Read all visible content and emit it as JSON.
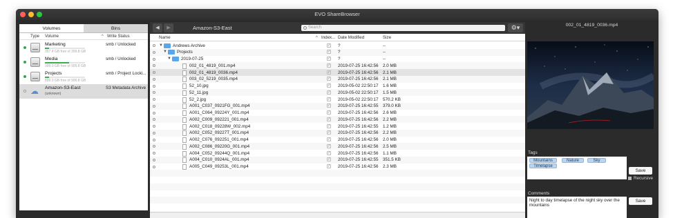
{
  "window": {
    "title": "EVO ShareBrowser"
  },
  "left": {
    "tabs": [
      "Volumes",
      "Bins"
    ],
    "columns": [
      "Type",
      "Volume",
      "Write Status"
    ],
    "volumes": [
      {
        "name": "Marketing",
        "sub": "357.4 GB free of 399.8 GB",
        "status": "smb / Unlocked",
        "online": true,
        "fill": 0.11
      },
      {
        "name": "Media",
        "sub": "399.0 GB free of 999.8 GB",
        "status": "smb / Unlocked",
        "online": true,
        "fill": 0.6
      },
      {
        "name": "Projects",
        "sub": "899.0 GB free of 999.8 GB",
        "status": "smb / Project Locki...",
        "online": true,
        "fill": 0.1
      },
      {
        "name": "Amazon-S3-East",
        "sub": "(unknown)",
        "status": "S3 Metadata Archive",
        "online": false
      }
    ]
  },
  "middle": {
    "back_icon": "◀",
    "forward_icon": "▶",
    "volume_title": "Amazon-S3-East",
    "search_placeholder": "Search",
    "gear_icon": "⚙▾",
    "columns": {
      "name": "Name",
      "index": "Index...",
      "date": "Date Modified",
      "size": "Size"
    },
    "rows": [
      {
        "level": 0,
        "kind": "folder",
        "open": true,
        "name": "Andrews Archive",
        "date": "?",
        "size": "--"
      },
      {
        "level": 1,
        "kind": "folder",
        "open": true,
        "name": "Projects",
        "date": "?",
        "size": "--"
      },
      {
        "level": 2,
        "kind": "folder",
        "open": true,
        "name": "2019-07-25",
        "date": "?",
        "size": "--"
      },
      {
        "level": 3,
        "kind": "file",
        "name": "002_01_4819_001.mp4",
        "date": "2019-07-25 16:42:56",
        "size": "2.0 MB"
      },
      {
        "level": 3,
        "kind": "file",
        "name": "002_01_4819_0036.mp4",
        "date": "2019-07-25 16:42:56",
        "size": "2.1 MB",
        "selected": true
      },
      {
        "level": 3,
        "kind": "file",
        "name": "003_02_5219_0035.mp4",
        "date": "2019-07-25 16:42:56",
        "size": "2.1 MB"
      },
      {
        "level": 3,
        "kind": "file",
        "name": "52_10.jpg",
        "date": "2019-05-02 22:50:17",
        "size": "1.6 MB"
      },
      {
        "level": 3,
        "kind": "file",
        "name": "52_11.jpg",
        "date": "2019-05-02 22:50:17",
        "size": "1.5 MB"
      },
      {
        "level": 3,
        "kind": "file",
        "name": "52_2.jpg",
        "date": "2019-05-02 22:50:17",
        "size": "570.2 KB"
      },
      {
        "level": 3,
        "kind": "file",
        "name": "A001_C037_0921FG_001.mp4",
        "date": "2019-07-25 16:42:55",
        "size": "379.0 KB"
      },
      {
        "level": 3,
        "kind": "file",
        "name": "A001_C064_09224Y_001.mp4",
        "date": "2019-07-25 16:42:56",
        "size": "2.6 MB"
      },
      {
        "level": 3,
        "kind": "file",
        "name": "A002_C009_092221_001.mp4",
        "date": "2019-07-25 16:42:56",
        "size": "2.2 MB"
      },
      {
        "level": 3,
        "kind": "file",
        "name": "A002_C018_09228W_002.mp4",
        "date": "2019-07-25 16:42:55",
        "size": "1.2 MB"
      },
      {
        "level": 3,
        "kind": "file",
        "name": "A002_C052_09227T_001.mp4",
        "date": "2019-07-25 16:42:56",
        "size": "2.2 MB"
      },
      {
        "level": 3,
        "kind": "file",
        "name": "A002_C076_092251_001.mp4",
        "date": "2019-07-25 16:42:56",
        "size": "2.0 MB"
      },
      {
        "level": 3,
        "kind": "file",
        "name": "A002_C086_09220G_001.mp4",
        "date": "2019-07-25 16:42:56",
        "size": "2.5 MB"
      },
      {
        "level": 3,
        "kind": "file",
        "name": "A004_C052_09244Q_001.mp4",
        "date": "2019-07-25 16:42:56",
        "size": "1.1 MB"
      },
      {
        "level": 3,
        "kind": "file",
        "name": "A004_C010_0924AL_001.mp4",
        "date": "2019-07-25 16:42:55",
        "size": "351.5 KB"
      },
      {
        "level": 3,
        "kind": "file",
        "name": "A005_C049_09253L_001.mp4",
        "date": "2019-07-25 16:42:56",
        "size": "2.3 MB"
      }
    ]
  },
  "right": {
    "preview_title": "002_01_4819_0036.mp4",
    "tags_label": "Tags",
    "tags": [
      "Mountains",
      "Nature",
      "Sky",
      "Timelapse"
    ],
    "save_label": "Save",
    "recursive_label": "Recursive",
    "comments_label": "Comments",
    "comment_text": "Night to day timelapse of the night sky over the mountains"
  }
}
